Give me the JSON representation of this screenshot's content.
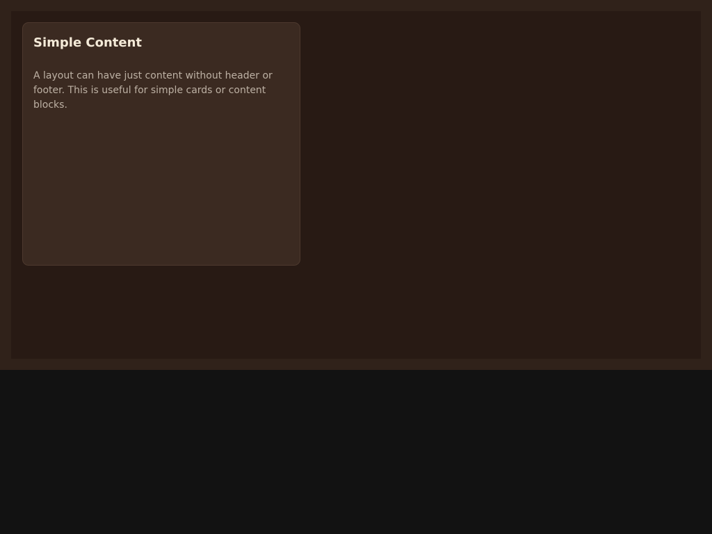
{
  "card": {
    "title": "Simple Content",
    "body": "A layout can have just content without header or footer. This is useful for simple cards or content blocks."
  },
  "colors": {
    "page_background": "#121212",
    "frame_background": "#30221a",
    "panel_background": "#281a14",
    "card_background": "#3b2a21",
    "card_border": "#4d392e",
    "title_text": "#f4ead8",
    "body_text": "#bdb1a4"
  }
}
